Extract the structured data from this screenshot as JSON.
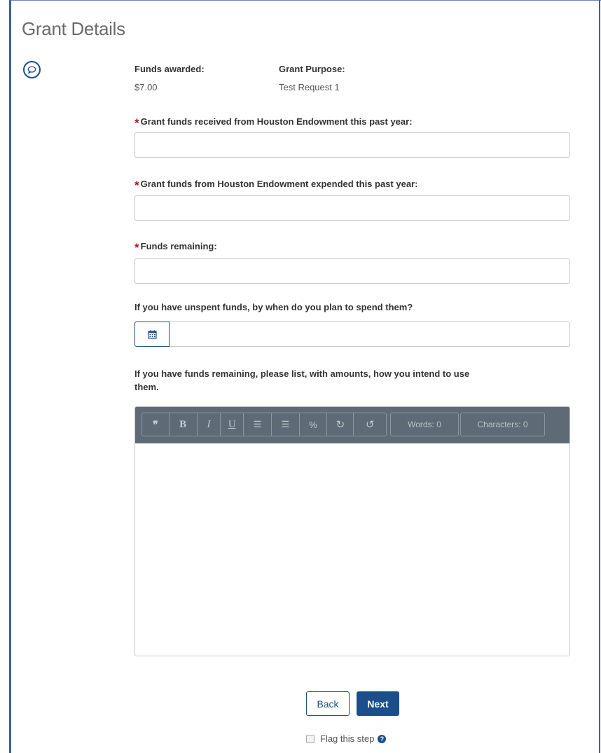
{
  "page": {
    "title": "Grant Details"
  },
  "summary": {
    "funds_awarded_label": "Funds awarded:",
    "funds_awarded_value": "$7.00",
    "grant_purpose_label": "Grant Purpose:",
    "grant_purpose_value": "Test Request 1"
  },
  "fields": {
    "received_label": "Grant funds received from Houston Endowment this past year:",
    "received_value": "",
    "expended_label": "Grant funds from Houston Endowment expended this past year:",
    "expended_value": "",
    "remaining_label": "Funds remaining:",
    "remaining_value": "",
    "spend_date_label": "If you have unspent funds, by when do you plan to spend them?",
    "spend_date_value": "",
    "use_plan_label_line1": "If you have funds remaining, please list, with amounts, how you intend to use",
    "use_plan_label_line2": "them.",
    "required_marker": "*"
  },
  "editor": {
    "toolbar": {
      "quote": "❞",
      "bold": "B",
      "italic": "I",
      "underline": "U",
      "bullet_list": "☰",
      "numbered_list": "☰",
      "link": "%",
      "redo": "↻",
      "undo": "↺"
    },
    "words_counter": "Words: 0",
    "characters_counter": "Characters: 0"
  },
  "actions": {
    "back_label": "Back",
    "next_label": "Next",
    "flag_label": "Flag this step",
    "help_glyph": "?"
  }
}
